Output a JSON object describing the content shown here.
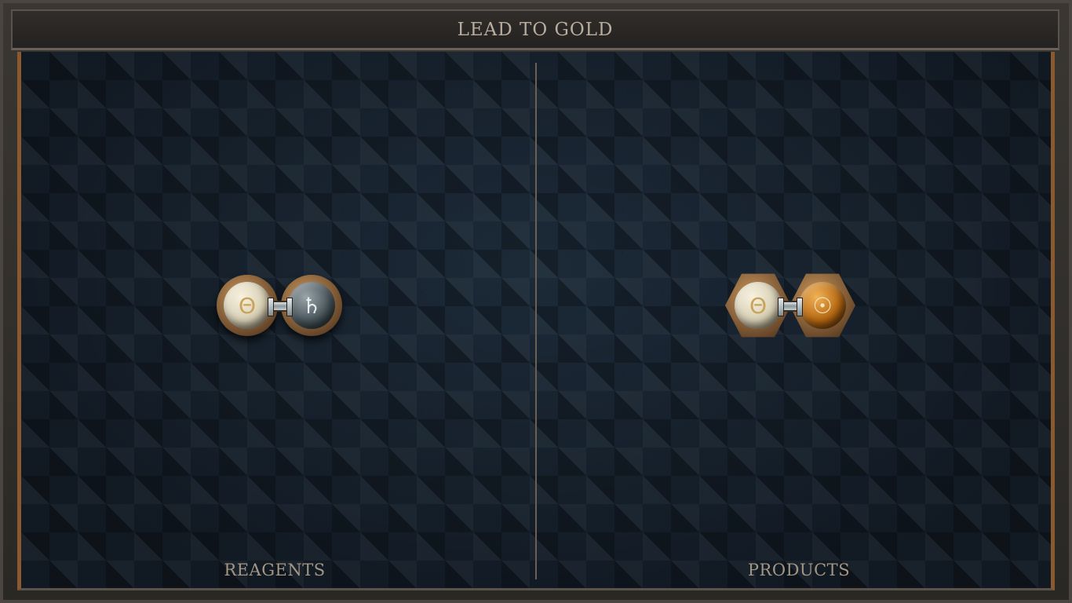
{
  "title": "LEAD TO GOLD",
  "panels": {
    "reagents": {
      "label": "REAGENTS",
      "atoms": [
        {
          "element": "salt",
          "symbol": "Θ",
          "color": "#e9e1c9"
        },
        {
          "element": "lead",
          "symbol": "♄",
          "color": "#4f5b61"
        }
      ]
    },
    "products": {
      "label": "PRODUCTS",
      "atoms": [
        {
          "element": "salt",
          "symbol": "Θ",
          "color": "#e9e1c9"
        },
        {
          "element": "gold",
          "symbol": "☉",
          "color": "#c27418"
        }
      ]
    }
  },
  "colors": {
    "frame_accent": "#8a5a2e",
    "board_background": "#141d26",
    "label_text": "#a39685"
  }
}
